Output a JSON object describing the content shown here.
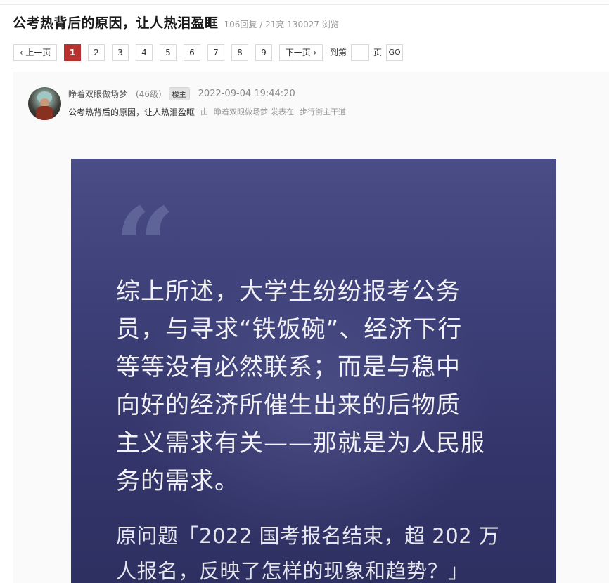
{
  "thread": {
    "title": "公考热背后的原因，让人热泪盈眶",
    "stats": "106回复 / 21亮 130027 浏览"
  },
  "pager": {
    "prev": "‹ 上一页",
    "pages": [
      "1",
      "2",
      "3",
      "4",
      "5",
      "6",
      "7",
      "8",
      "9"
    ],
    "current": "1",
    "next": "下一页 ›",
    "goto_prefix": "到第",
    "goto_suffix": "页",
    "go": "GO"
  },
  "post": {
    "author": "睁着双眼做场梦",
    "level": "(46级)",
    "badge": "楼主",
    "time": "2022-09-04 19:44:20",
    "subtitle": "公考热背后的原因，让人热泪盈眶",
    "by": "由",
    "by_author": "睁着双眼做场梦",
    "posted_in": "发表在",
    "forum": "步行街主干道"
  },
  "image": {
    "quote_mark": "“",
    "body_lines": [
      "综上所述，大学生纷纷报考公务",
      "员，与寻求“铁饭碗”、经济下行",
      "等等没有必然联系；而是与稳中",
      "向好的经济所催生出来的后物质",
      "主义需求有关——那就是为人民服",
      "务的需求。"
    ],
    "footer_lines": [
      "原问题「2022 国考报名结束，超 202 万",
      "人报名，反映了怎样的现象和趋势？」"
    ]
  }
}
